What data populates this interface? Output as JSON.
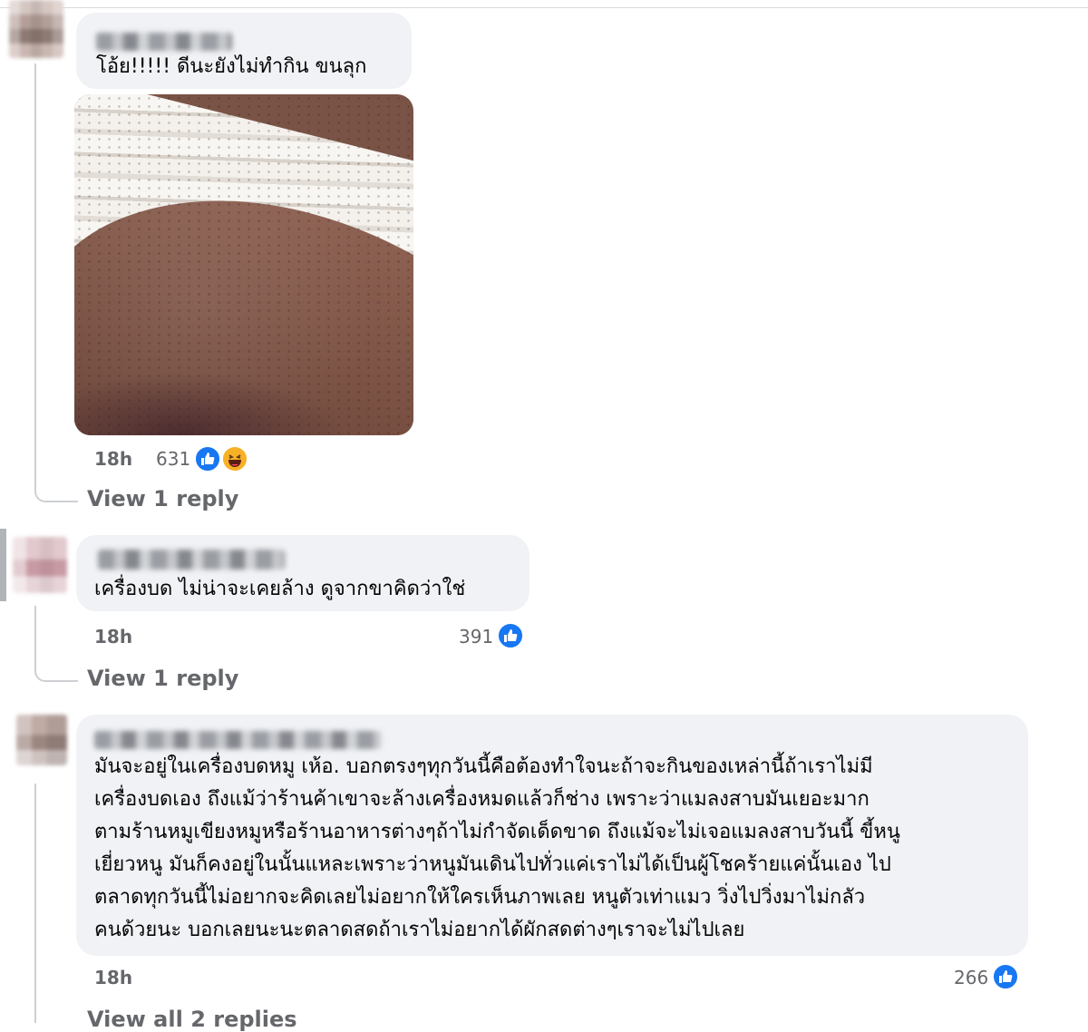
{
  "comments": [
    {
      "text": "โอ้ย!!!!! ดีนะยังไม่ทำกิน ขนลุก",
      "time": "18h",
      "reaction_count": "631",
      "reactions": [
        "like-icon",
        "haha-icon"
      ],
      "view_replies": "View 1 reply"
    },
    {
      "text": "เครื่องบด ไม่น่าจะเคยล้าง ดูจากขาคิดว่าใช่",
      "time": "18h",
      "reaction_count": "391",
      "reactions": [
        "like-icon"
      ],
      "view_replies": "View 1 reply"
    },
    {
      "lines": [
        "มันจะอยู่ในเครื่องบดหมู เห้อ. บอกตรงๆทุกวันนี้คือต้องทำใจนะถ้าจะกินของเหล่านี้ถ้าเราไม่มี",
        "เครื่องบดเอง ถึงแม้ว่าร้านค้าเขาจะล้างเครื่องหมดแล้วก็ช่าง เพราะว่าแมลงสาบมันเยอะมาก",
        "ตามร้านหมูเขียงหมูหรือร้านอาหารต่างๆถ้าไม่กำจัดเด็ดขาด ถึงแม้จะไม่เจอแมลงสาบวันนี้ ขี้หนู",
        "เยี่ยวหนู มันก็คงอยู่ในนั้นแหละเพราะว่าหนูมันเดินไปทั่วแค่เราไม่ได้เป็นผู้โชคร้ายแค่นั้นเอง ไป",
        "ตลาดทุกวันนี้ไม่อยากจะคิดเลยไม่อยากให้ใครเห็นภาพเลย หนูตัวเท่าแมว วิ่งไปวิ่งมาไม่กลัว",
        "คนด้วยนะ บอกเลยนะนะตลาดสดถ้าเราไม่อยากได้ผักสดต่างๆเราจะไม่ไปเลย"
      ],
      "time": "18h",
      "reaction_count": "266",
      "reactions": [
        "like-icon"
      ],
      "view_replies": "View all 2 replies"
    }
  ],
  "colors": {
    "bubble": "#f0f2f5",
    "meta": "#65676b",
    "like": "#1877f2",
    "haha": "#f7b125"
  }
}
